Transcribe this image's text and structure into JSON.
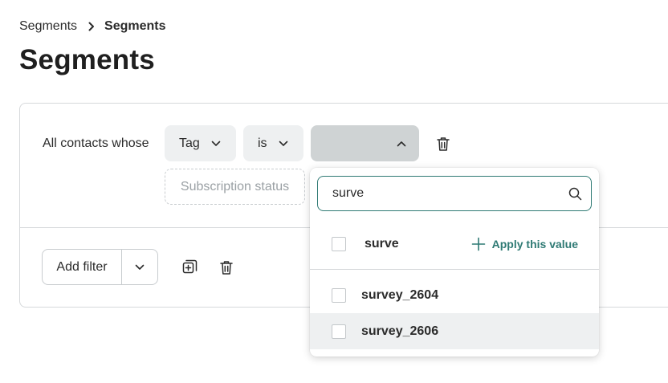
{
  "breadcrumb": {
    "parent": "Segments",
    "current": "Segments"
  },
  "page": {
    "title": "Segments"
  },
  "rule": {
    "label": "All contacts whose",
    "field": "Tag",
    "operator": "is",
    "value": "",
    "subscription_status_placeholder": "Subscription status"
  },
  "actions": {
    "add_filter_label": "Add filter"
  },
  "dropdown": {
    "search_value": "surve",
    "typed_option": "surve",
    "apply_label": "Apply this value",
    "options": [
      {
        "label": "survey_2604",
        "checked": false
      },
      {
        "label": "survey_2606",
        "checked": false,
        "hovered": true
      }
    ]
  },
  "colors": {
    "accent": "#2f7a74",
    "chip_bg": "#eef0f1",
    "chip_active_bg": "#cfd3d4",
    "border": "#d6d9db"
  },
  "icons": {
    "chevron": "chevron-down-icon",
    "chevron_up": "chevron-up-icon",
    "trash": "trash-icon",
    "search": "search-icon",
    "plus": "plus-icon",
    "duplicate": "duplicate-icon"
  }
}
